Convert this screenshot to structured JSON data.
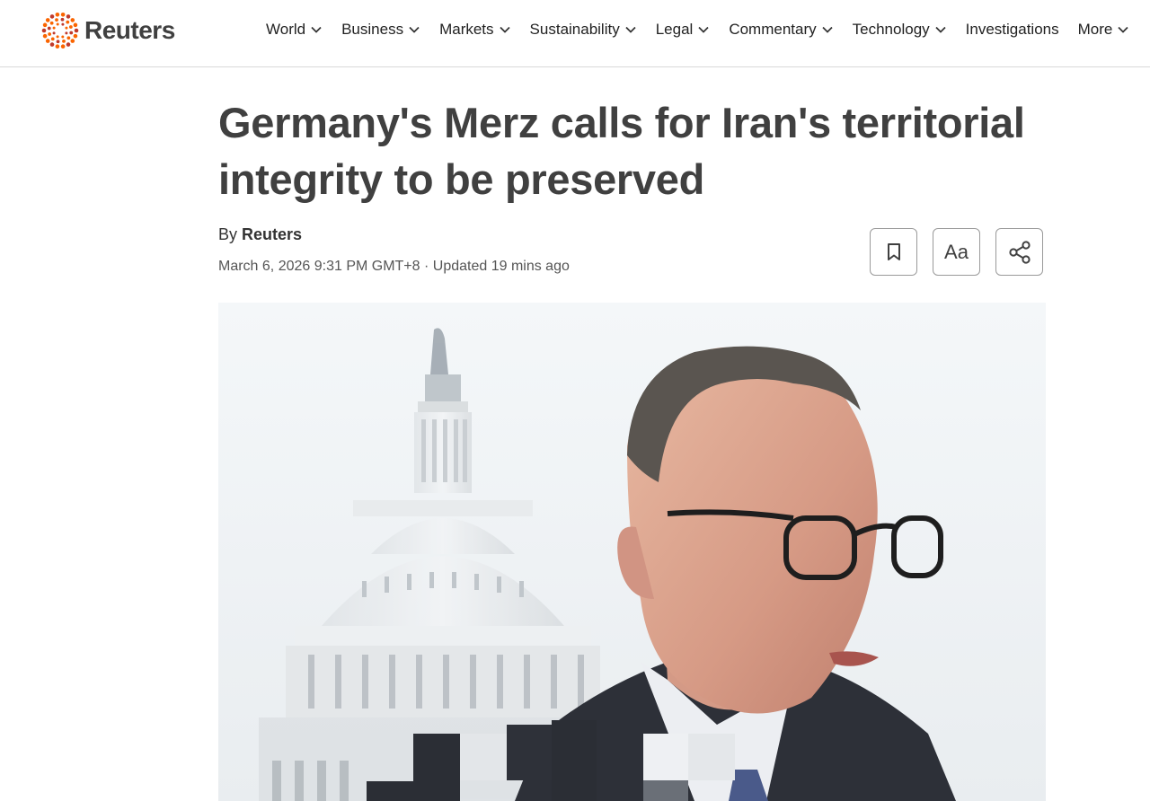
{
  "site": {
    "brand": "Reuters",
    "logo_icon": "reuters-dot-ring-logo",
    "brand_color": "#fa6400"
  },
  "nav": {
    "items": [
      {
        "label": "World",
        "has_dropdown": true
      },
      {
        "label": "Business",
        "has_dropdown": true
      },
      {
        "label": "Markets",
        "has_dropdown": true
      },
      {
        "label": "Sustainability",
        "has_dropdown": true
      },
      {
        "label": "Legal",
        "has_dropdown": true
      },
      {
        "label": "Commentary",
        "has_dropdown": true
      },
      {
        "label": "Technology",
        "has_dropdown": true
      },
      {
        "label": "Investigations",
        "has_dropdown": false
      },
      {
        "label": "More",
        "has_dropdown": true
      }
    ]
  },
  "article": {
    "headline": "Germany's Merz calls for Iran's territorial integrity to be preserved",
    "byline_prefix": "By",
    "author": "Reuters",
    "dateline": "March 6, 2026 9:31 PM GMT+8 · Updated 19 mins ago",
    "tools": {
      "bookmark_icon": "bookmark-icon",
      "text_size_label": "Aa",
      "share_icon": "share-icon"
    }
  },
  "photo": {
    "subject_description_icon": "article-hero-photo"
  }
}
